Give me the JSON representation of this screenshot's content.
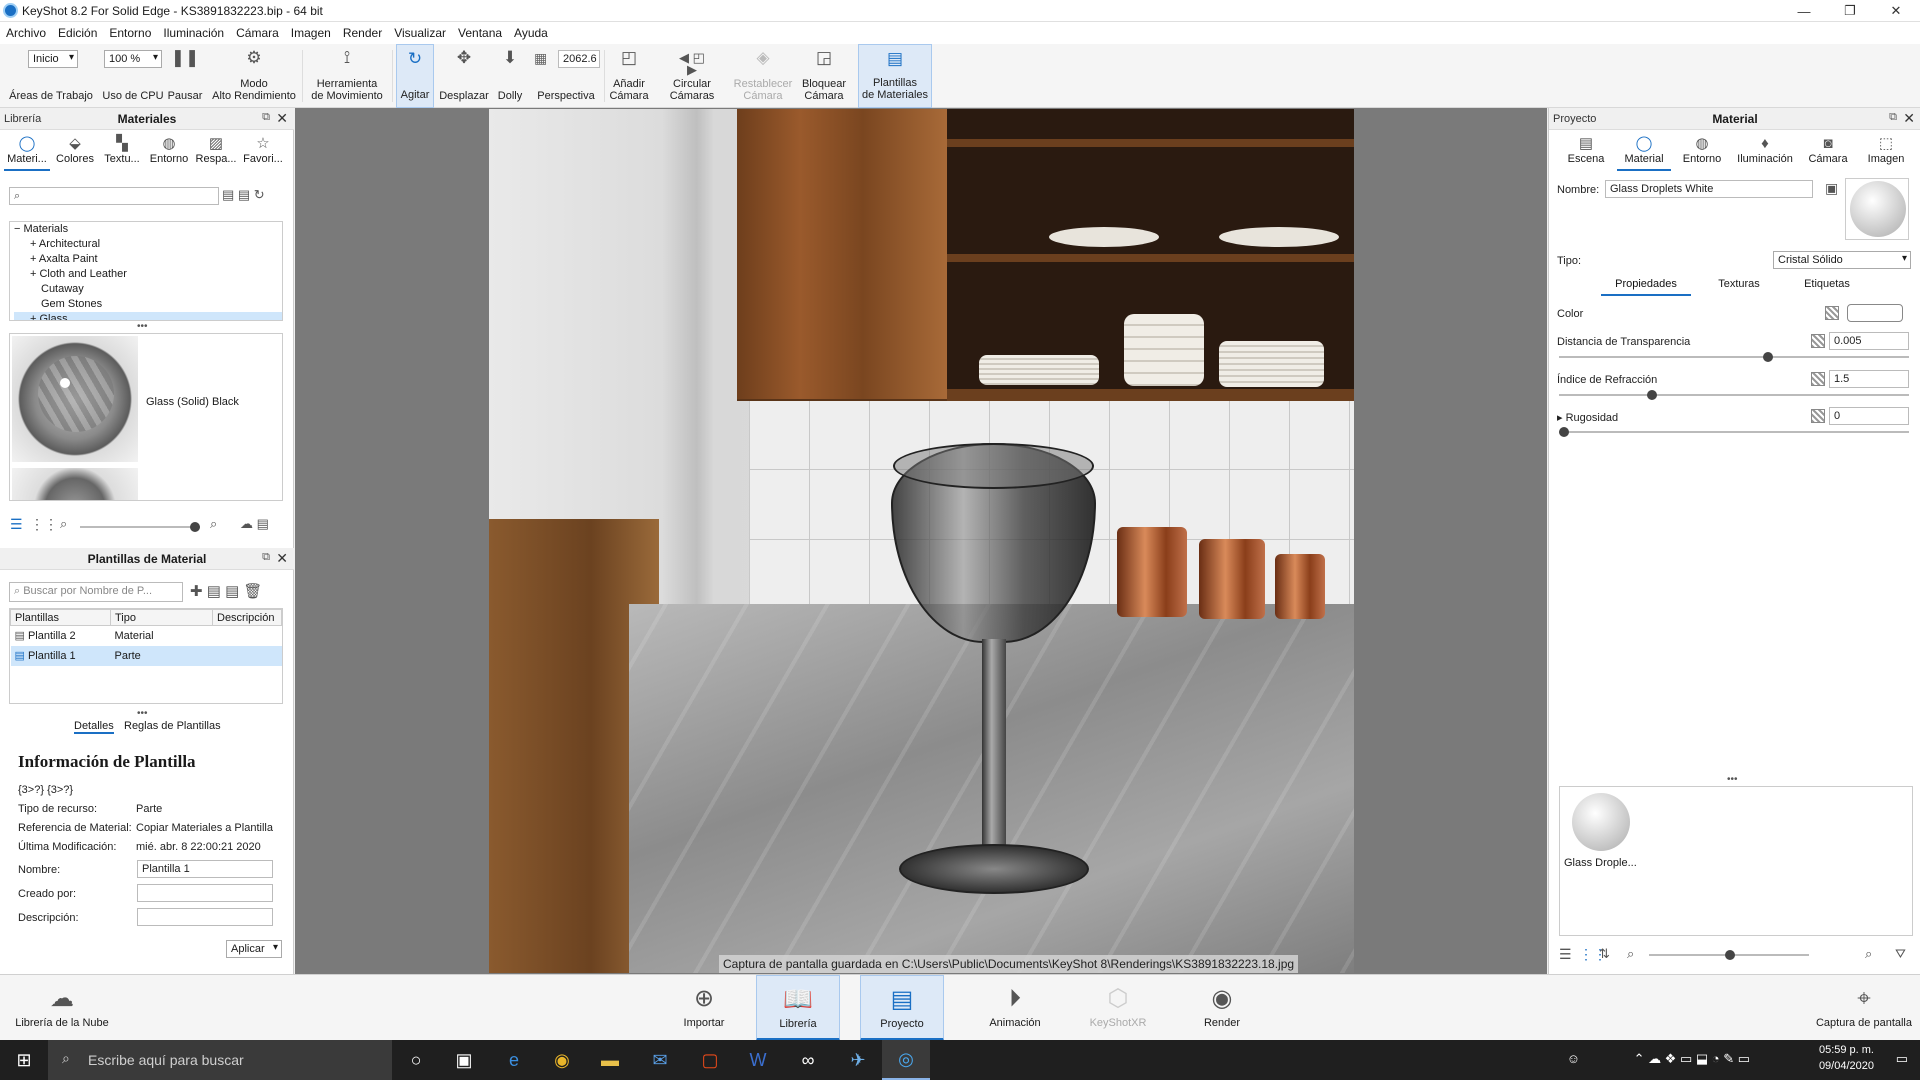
{
  "window": {
    "title": "KeyShot 8.2 For Solid Edge - KS3891832223.bip - 64 bit"
  },
  "menu": [
    "Archivo",
    "Edición",
    "Entorno",
    "Iluminación",
    "Cámara",
    "Imagen",
    "Render",
    "Visualizar",
    "Ventana",
    "Ayuda"
  ],
  "toolbar": {
    "workspace_value": "Inicio",
    "workspace_label": "Áreas de Trabajo",
    "cpu_value": "100 %",
    "cpu_label": "Uso de CPU",
    "pause": "Pausar",
    "perf": "Modo\nAlto Rendimiento",
    "move_tool": "Herramienta\nde Movimiento",
    "tumble": "Agitar",
    "pan": "Desplazar",
    "dolly": "Dolly",
    "perspective_value": "2062.6",
    "perspective": "Perspectiva",
    "add_camera": "Añadir\nCámara",
    "orbit_cameras": "Circular\nCámaras",
    "reset_camera": "Restablecer\nCámara",
    "lock_camera": "Bloquear\nCámara",
    "material_templates": "Plantillas\nde Materiales"
  },
  "library": {
    "panel_left": "Librería",
    "title": "Materiales",
    "tabs": [
      "Materi...",
      "Colores",
      "Textu...",
      "Entorno",
      "Respa...",
      "Favori..."
    ],
    "tree": [
      "Materials",
      "Architectural",
      "Axalta Paint",
      "Cloth and Leather",
      "Cutaway",
      "Gem Stones",
      "Glass"
    ],
    "preview_label": "Glass (Solid) Black"
  },
  "templates": {
    "title": "Plantillas de Material",
    "search_placeholder": "Buscar por Nombre de P...",
    "columns": [
      "Plantillas",
      "Tipo",
      "Descripción"
    ],
    "rows": [
      {
        "name": "Plantilla 2",
        "type": "Material"
      },
      {
        "name": "Plantilla 1",
        "type": "Parte"
      }
    ],
    "tabs": [
      "Detalles",
      "Reglas de Plantillas"
    ],
    "info_title": "Información de Plantilla",
    "info_id": "{3>?} {3>?}",
    "fields": [
      {
        "k": "Tipo de recurso:",
        "v": "Parte"
      },
      {
        "k": "Referencia de Material:",
        "v": "Copiar Materiales a Plantilla"
      },
      {
        "k": "Última Modificación:",
        "v": "mié. abr. 8 22:00:21 2020"
      }
    ],
    "name_label": "Nombre:",
    "name_value": "Plantilla 1",
    "creator_label": "Creado por:",
    "desc_label": "Descripción:",
    "apply": "Aplicar"
  },
  "viewport": {
    "status": "Captura de pantalla guardada en C:\\Users\\Public\\Documents\\KeyShot 8\\Renderings\\KS3891832223.18.jpg"
  },
  "project": {
    "panel_left": "Proyecto",
    "title": "Material",
    "tabs": [
      "Escena",
      "Material",
      "Entorno",
      "Iluminación",
      "Cámara",
      "Imagen"
    ],
    "name_label": "Nombre:",
    "name_value": "Glass Droplets White",
    "type_label": "Tipo:",
    "type_value": "Cristal Sólido",
    "subtabs": [
      "Propiedades",
      "Texturas",
      "Etiquetas"
    ],
    "props": [
      {
        "label": "Color",
        "value": ""
      },
      {
        "label": "Distancia de Transparencia",
        "value": "0.005",
        "slider": 0.6
      },
      {
        "label": "Índice de Refracción",
        "value": "1.5",
        "slider": 0.26
      },
      {
        "label": "Rugosidad",
        "value": "0",
        "slider": 0.0
      }
    ],
    "thumb_label": "Glass Drople..."
  },
  "bottombar": {
    "cloud": "Librería de la Nube",
    "import": "Importar",
    "library": "Librería",
    "project": "Proyecto",
    "animation": "Animación",
    "keyshotxr": "KeyShotXR",
    "render": "Render",
    "screenshot": "Captura de pantalla"
  },
  "taskbar": {
    "search": "Escribe aquí para buscar",
    "time": "05:59 p. m.",
    "date": "09/04/2020"
  }
}
